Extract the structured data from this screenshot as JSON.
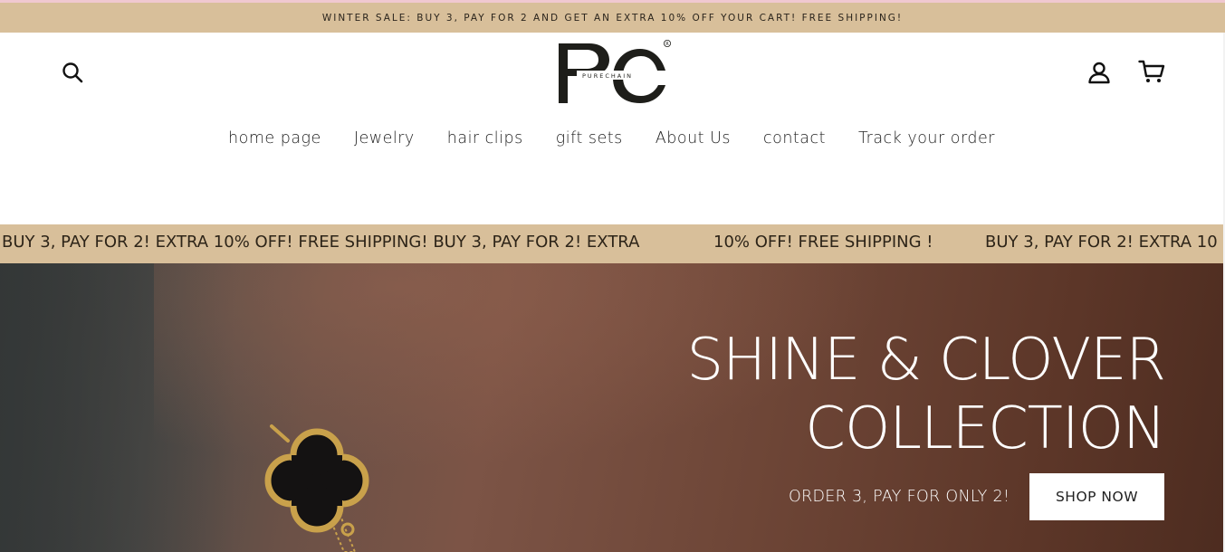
{
  "announcement": {
    "text": "WINTER SALE: BUY 3, PAY FOR 2 AND GET AN EXTRA 10% OFF YOUR CART! FREE SHIPPING!"
  },
  "header": {
    "logo": {
      "monogram": "PC",
      "wordmark": "PURECHAIN",
      "mark": "®"
    },
    "icons": {
      "search": "search-icon",
      "account": "user-icon",
      "cart": "cart-icon"
    }
  },
  "nav": {
    "items": [
      {
        "label": "home page"
      },
      {
        "label": "Jewelry"
      },
      {
        "label": "hair clips"
      },
      {
        "label": "gift sets"
      },
      {
        "label": "About Us"
      },
      {
        "label": "contact"
      },
      {
        "label": "Track your order"
      }
    ]
  },
  "marquee": {
    "segments": [
      "BUY 3, PAY FOR 2! EXTRA 10% OFF! FREE SHIPPING! BUY 3, PAY FOR 2! EXTRA",
      "10% OFF! FREE SHIPPING !",
      "BUY 3, PAY FOR 2! EXTRA 10"
    ]
  },
  "hero": {
    "title_line1": "SHINE & CLOVER",
    "title_line2": "COLLECTION",
    "subtitle": "ORDER 3, PAY FOR ONLY 2!",
    "cta": "SHOP NOW"
  },
  "colors": {
    "band": "#d8bf9a",
    "text_dark": "#222222",
    "top_strip": "#f0c8d0"
  }
}
